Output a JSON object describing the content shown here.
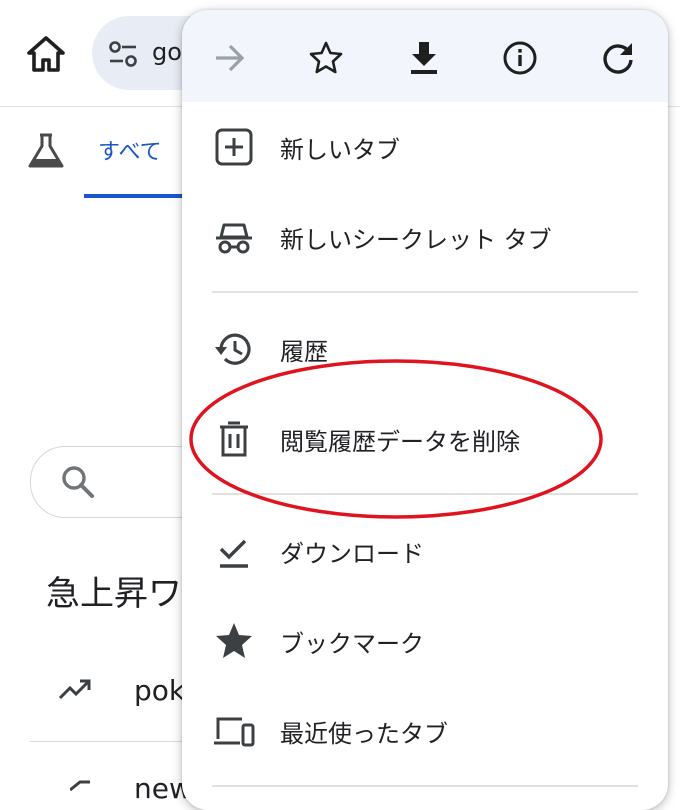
{
  "browser": {
    "url_fragment": "go",
    "tabs": {
      "all_label": "すべて"
    },
    "trending": {
      "title": "急上昇ワ",
      "items": [
        "pok",
        "new"
      ]
    }
  },
  "menu": {
    "toolbar": [
      "forward-icon",
      "bookmark-star-icon",
      "download-icon",
      "info-icon",
      "reload-icon"
    ],
    "items": [
      {
        "label": "新しいタブ",
        "icon": "new-tab-icon"
      },
      {
        "label": "新しいシークレット タブ",
        "icon": "incognito-icon"
      },
      {
        "label": "履歴",
        "icon": "history-icon"
      },
      {
        "label": "閲覧履歴データを削除",
        "icon": "trash-icon"
      },
      {
        "label": "ダウンロード",
        "icon": "downloads-icon"
      },
      {
        "label": "ブックマーク",
        "icon": "star-icon"
      },
      {
        "label": "最近使ったタブ",
        "icon": "devices-icon"
      }
    ]
  },
  "annotation": {
    "shape": "red ellipse",
    "color": "#e0141e",
    "highlighted_item": "閲覧履歴データを削除"
  },
  "colors": {
    "accent": "#1a56c8",
    "icon": "#3c4043",
    "toolbar_bg": "#f2f5fb",
    "omnibox_bg": "#e8edf5"
  }
}
